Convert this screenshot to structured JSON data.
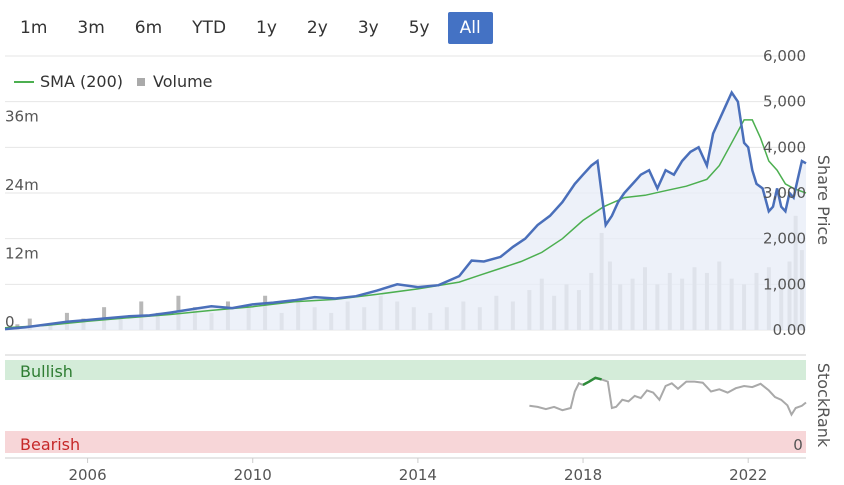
{
  "range_buttons": [
    {
      "label": "1m",
      "active": false
    },
    {
      "label": "3m",
      "active": false
    },
    {
      "label": "6m",
      "active": false
    },
    {
      "label": "YTD",
      "active": false
    },
    {
      "label": "1y",
      "active": false
    },
    {
      "label": "2y",
      "active": false
    },
    {
      "label": "3y",
      "active": false
    },
    {
      "label": "5y",
      "active": false
    },
    {
      "label": "All",
      "active": true
    }
  ],
  "legend": {
    "sma_label": "SMA (200)",
    "volume_label": "Volume"
  },
  "colors": {
    "price_line": "#4a6fba",
    "price_fill": "#e9edf8",
    "sma_line": "#4caf50",
    "volume_bar": "#b8b8b8",
    "stockrank_line": "#a9a9a9",
    "stockrank_high": "#2e8b3a",
    "bullish_band": "#d4ecd9",
    "bearish_band": "#f7d6d8",
    "bullish_text": "#2e7d32",
    "bearish_text": "#c62828"
  },
  "chart_data": [
    {
      "type": "line",
      "series": [
        {
          "name": "Share Price",
          "x": [
            2004.0,
            2004.5,
            2005.0,
            2005.5,
            2006.0,
            2006.5,
            2007.0,
            2007.5,
            2008.0,
            2008.5,
            2009.0,
            2009.5,
            2010.0,
            2010.5,
            2011.0,
            2011.5,
            2012.0,
            2012.5,
            2013.0,
            2013.5,
            2014.0,
            2014.5,
            2015.0,
            2015.3,
            2015.6,
            2016.0,
            2016.3,
            2016.6,
            2016.9,
            2017.2,
            2017.5,
            2017.8,
            2018.0,
            2018.2,
            2018.35,
            2018.55,
            2018.7,
            2018.85,
            2019.0,
            2019.2,
            2019.4,
            2019.6,
            2019.8,
            2020.0,
            2020.2,
            2020.4,
            2020.6,
            2020.8,
            2021.0,
            2021.15,
            2021.3,
            2021.45,
            2021.6,
            2021.75,
            2021.9,
            2022.0,
            2022.1,
            2022.2,
            2022.35,
            2022.5,
            2022.6,
            2022.7,
            2022.8,
            2022.9,
            2023.0,
            2023.1,
            2023.2,
            2023.3,
            2023.4
          ],
          "y": [
            20,
            60,
            120,
            180,
            220,
            260,
            300,
            320,
            380,
            450,
            520,
            480,
            560,
            600,
            650,
            720,
            690,
            740,
            860,
            1000,
            940,
            980,
            1180,
            1520,
            1500,
            1600,
            1820,
            2000,
            2300,
            2500,
            2800,
            3200,
            3400,
            3600,
            3700,
            2300,
            2500,
            2800,
            3000,
            3200,
            3400,
            3500,
            3100,
            3500,
            3400,
            3700,
            3900,
            4000,
            3600,
            4300,
            4600,
            4900,
            5200,
            5000,
            4100,
            4000,
            3500,
            3200,
            3100,
            2600,
            2700,
            3100,
            2700,
            2600,
            3000,
            2900,
            3300,
            3700,
            3650
          ]
        },
        {
          "name": "SMA (200)",
          "x": [
            2004.0,
            2005.0,
            2006.0,
            2007.0,
            2008.0,
            2009.0,
            2010.0,
            2011.0,
            2012.0,
            2013.0,
            2014.0,
            2015.0,
            2015.5,
            2016.0,
            2016.5,
            2017.0,
            2017.5,
            2018.0,
            2018.5,
            2019.0,
            2019.5,
            2020.0,
            2020.5,
            2021.0,
            2021.3,
            2021.6,
            2021.9,
            2022.1,
            2022.3,
            2022.5,
            2022.7,
            2022.9,
            2023.1,
            2023.4
          ],
          "y": [
            50,
            100,
            190,
            270,
            340,
            430,
            510,
            620,
            670,
            780,
            900,
            1050,
            1200,
            1350,
            1500,
            1700,
            2000,
            2400,
            2700,
            2900,
            2950,
            3050,
            3150,
            3300,
            3600,
            4100,
            4600,
            4600,
            4200,
            3700,
            3500,
            3200,
            3100,
            3000
          ]
        }
      ],
      "ylabel": "Share Price",
      "ylim": [
        0,
        6000
      ],
      "yticks": [
        "0.00",
        "1,000",
        "2,000",
        "3,000",
        "4,000",
        "5,000",
        "6,000"
      ]
    },
    {
      "type": "bar",
      "series": [
        {
          "name": "Volume",
          "x": [
            2004.3,
            2004.6,
            2005.1,
            2005.5,
            2005.9,
            2006.4,
            2006.8,
            2007.3,
            2007.7,
            2008.2,
            2008.6,
            2009.0,
            2009.4,
            2009.9,
            2010.3,
            2010.7,
            2011.1,
            2011.5,
            2011.9,
            2012.3,
            2012.7,
            2013.1,
            2013.5,
            2013.9,
            2014.3,
            2014.7,
            2015.1,
            2015.5,
            2015.9,
            2016.3,
            2016.7,
            2017.0,
            2017.3,
            2017.6,
            2017.9,
            2018.2,
            2018.45,
            2018.65,
            2018.9,
            2019.2,
            2019.5,
            2019.8,
            2020.1,
            2020.4,
            2020.7,
            2021.0,
            2021.3,
            2021.6,
            2021.9,
            2022.2,
            2022.5,
            2022.8,
            2023.0,
            2023.15,
            2023.3
          ],
          "y": [
            1,
            2,
            1,
            3,
            2,
            4,
            2,
            5,
            3,
            6,
            4,
            3,
            5,
            4,
            6,
            3,
            5,
            4,
            3,
            5,
            4,
            6,
            5,
            4,
            3,
            4,
            5,
            4,
            6,
            5,
            7,
            9,
            6,
            8,
            7,
            10,
            17,
            12,
            8,
            9,
            11,
            8,
            10,
            9,
            11,
            10,
            12,
            9,
            8,
            10,
            11,
            9,
            12,
            20,
            14
          ]
        }
      ],
      "yticks": [
        "0",
        "12m",
        "24m",
        "36m"
      ],
      "ylim": [
        0,
        48
      ]
    },
    {
      "type": "line",
      "series": [
        {
          "name": "StockRank",
          "x": [
            2016.7,
            2016.9,
            2017.1,
            2017.3,
            2017.5,
            2017.7,
            2017.8,
            2017.9,
            2018.0,
            2018.15,
            2018.3,
            2018.45,
            2018.6,
            2018.7,
            2018.8,
            2018.95,
            2019.1,
            2019.25,
            2019.4,
            2019.55,
            2019.7,
            2019.85,
            2020.0,
            2020.15,
            2020.3,
            2020.5,
            2020.7,
            2020.9,
            2021.1,
            2021.3,
            2021.5,
            2021.7,
            2021.9,
            2022.1,
            2022.3,
            2022.5,
            2022.65,
            2022.8,
            2022.95,
            2023.05,
            2023.15,
            2023.3,
            2023.4
          ],
          "y": [
            44,
            42,
            38,
            42,
            36,
            40,
            70,
            85,
            82,
            88,
            95,
            92,
            88,
            40,
            42,
            55,
            52,
            62,
            58,
            72,
            68,
            55,
            80,
            85,
            75,
            88,
            88,
            86,
            70,
            74,
            68,
            76,
            80,
            78,
            84,
            72,
            60,
            55,
            45,
            28,
            40,
            44,
            50
          ]
        }
      ],
      "ylabel": "StockRank",
      "ylim": [
        0,
        100
      ],
      "yticks": [
        "0"
      ],
      "bands": [
        "Bullish",
        "Bearish"
      ]
    }
  ],
  "x_axis": {
    "ticks": [
      2006,
      2010,
      2014,
      2018,
      2022
    ],
    "range": [
      2004.0,
      2023.4
    ]
  }
}
